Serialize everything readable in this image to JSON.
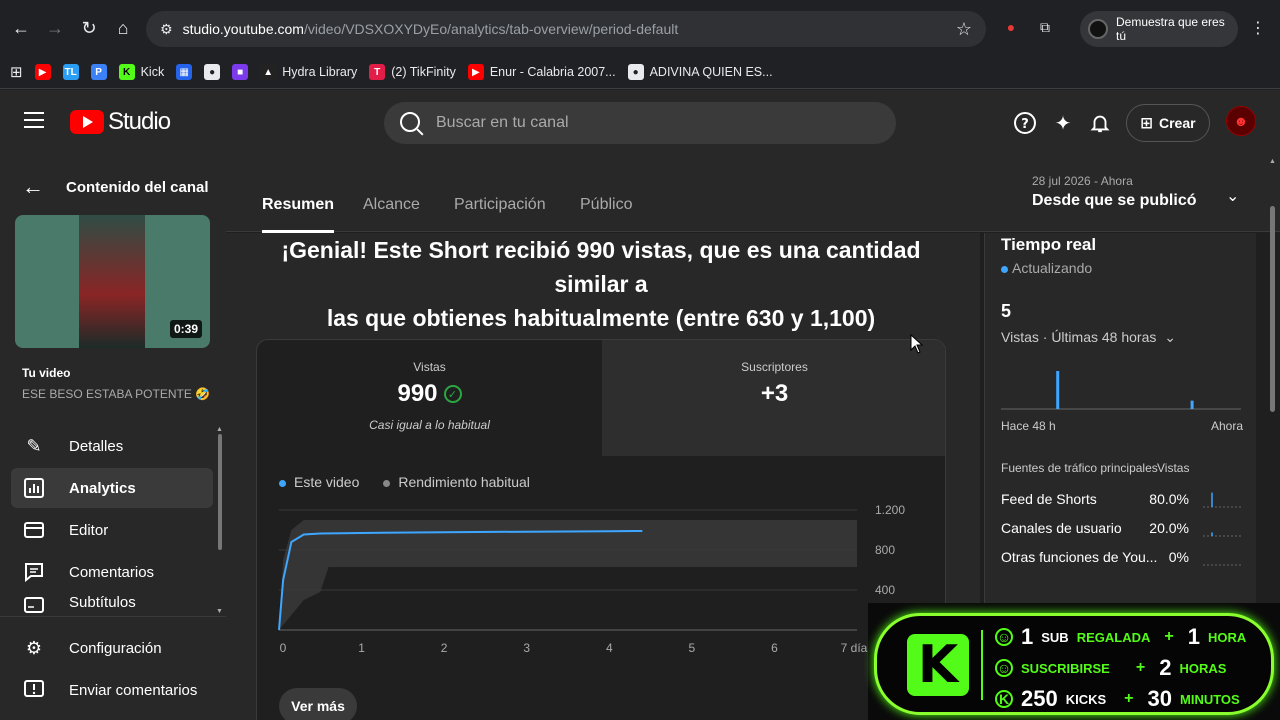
{
  "browser": {
    "url_domain": "studio.youtube.com",
    "url_path": "/video/VDSXOXYDyEo/analytics/tab-overview/period-default",
    "profile_label": "Demuestra que eres tú",
    "bookmarks": [
      {
        "label": "",
        "color": "#ff0000",
        "glyph": "▶"
      },
      {
        "label": "",
        "color": "#2a9df4",
        "glyph": "TL"
      },
      {
        "label": "",
        "color": "#3b82f6",
        "glyph": "P"
      },
      {
        "label": "Kick",
        "color": "#53fc18",
        "glyph": "K"
      },
      {
        "label": "",
        "color": "#2563eb",
        "glyph": "▦"
      },
      {
        "label": "",
        "color": "#e8eaed",
        "glyph": "●"
      },
      {
        "label": "",
        "color": "#7c3aed",
        "glyph": "■"
      },
      {
        "label": "Hydra Library",
        "color": "#222222",
        "glyph": "▲"
      },
      {
        "label": "(2) TikFinity",
        "color": "#e11d48",
        "glyph": "T"
      },
      {
        "label": "Enur - Calabria 2007...",
        "color": "#ff0000",
        "glyph": "▶"
      },
      {
        "label": "ADIVINA QUIEN ES...",
        "color": "#e8eaed",
        "glyph": "●"
      }
    ]
  },
  "studio": {
    "logo_text": "Studio",
    "search_placeholder": "Buscar en tu canal",
    "create_label": "Crear"
  },
  "sidebar": {
    "back_label": "Contenido del canal",
    "thumb_duration": "0:39",
    "your_video_label": "Tu video",
    "video_title": "ESE BESO ESTABA POTENTE 🤣 ...",
    "items": [
      {
        "label": "Detalles",
        "icon": "pencil-icon"
      },
      {
        "label": "Analytics",
        "icon": "analytics-icon"
      },
      {
        "label": "Editor",
        "icon": "editor-icon"
      },
      {
        "label": "Comentarios",
        "icon": "comments-icon"
      },
      {
        "label": "Subtítulos",
        "icon": "subtitles-icon"
      }
    ],
    "bottom": [
      {
        "label": "Configuración",
        "icon": "gear-icon"
      },
      {
        "label": "Enviar comentarios",
        "icon": "feedback-icon"
      }
    ]
  },
  "tabs": {
    "items": [
      "Resumen",
      "Alcance",
      "Participación",
      "Público"
    ],
    "active": "Resumen",
    "date_small": "28 jul 2026 - Ahora",
    "date_big": "Desde que se publicó"
  },
  "main": {
    "headline_1": "¡Genial! Este Short recibió 990 vistas, que es una cantidad similar a",
    "headline_2": "las que obtienes habitualmente (entre 630 y 1,100)",
    "metric_views_label": "Vistas",
    "metric_views_value": "990",
    "metric_views_sub": "Casi igual a lo habitual",
    "metric_subs_label": "Suscriptores",
    "metric_subs_value": "+3",
    "legend_this": "Este video",
    "legend_typical": "Rendimiento habitual",
    "see_more": "Ver más"
  },
  "chart_data": {
    "type": "line",
    "x_ticks": [
      "0",
      "1",
      "2",
      "3",
      "4",
      "5",
      "6",
      "7 días"
    ],
    "y_ticks": [
      "1.200",
      "800",
      "400"
    ],
    "xlim": [
      0,
      7
    ],
    "ylim": [
      0,
      1200
    ],
    "series": [
      {
        "name": "Este video",
        "color": "#3ea6ff",
        "x": [
          0,
          0.05,
          0.15,
          0.3,
          0.5,
          1,
          2,
          3,
          4,
          4.4
        ],
        "y": [
          0,
          500,
          880,
          955,
          965,
          970,
          978,
          983,
          988,
          990
        ]
      }
    ],
    "typical_band": {
      "name": "Rendimiento habitual",
      "x": [
        0,
        0.05,
        0.15,
        0.3,
        0.5,
        0.6,
        1,
        2,
        3,
        4,
        5,
        6,
        7
      ],
      "lower": [
        0,
        50,
        150,
        300,
        380,
        630,
        630,
        630,
        630,
        630,
        630,
        630,
        630
      ],
      "upper": [
        0,
        700,
        1000,
        1100,
        1100,
        1100,
        1100,
        1100,
        1100,
        1100,
        1100,
        1100,
        1100
      ]
    }
  },
  "realtime": {
    "title": "Tiempo real",
    "status": "Actualizando",
    "count": "5",
    "views_label": "Vistas · Últimas 48 horas",
    "axis_left": "Hace 48 h",
    "axis_right": "Ahora",
    "bars": [
      {
        "position": 0.23,
        "value": 1.0
      },
      {
        "position": 0.79,
        "value": 0.22
      }
    ],
    "sources_header": "Fuentes de tráfico principales",
    "sources_views_header": "Vistas",
    "sources": [
      {
        "name": "Feed de Shorts",
        "pct": "80.0%",
        "spark_value": 0.8
      },
      {
        "name": "Canales de usuario",
        "pct": "20.0%",
        "spark_value": 0.2
      },
      {
        "name": "Otras funciones de You...",
        "pct": "0%",
        "spark_value": 0
      }
    ]
  },
  "overlay": {
    "rows": [
      {
        "num1": "1",
        "word1": "SUB",
        "green1": "REGALADA",
        "num2": "1",
        "word2": "HORA"
      },
      {
        "num1": "",
        "word1": "",
        "green1": "SUSCRIBIRSE",
        "num2": "2",
        "word2": "HORAS"
      },
      {
        "num1": "250",
        "word1": "KICKS",
        "green1": "",
        "num2": "30",
        "word2": "MINUTOS"
      }
    ]
  },
  "colors": {
    "accent": "#3ea6ff",
    "kick_green": "#53fc18",
    "check_green": "#2ba640",
    "yt_red": "#ff0000"
  }
}
